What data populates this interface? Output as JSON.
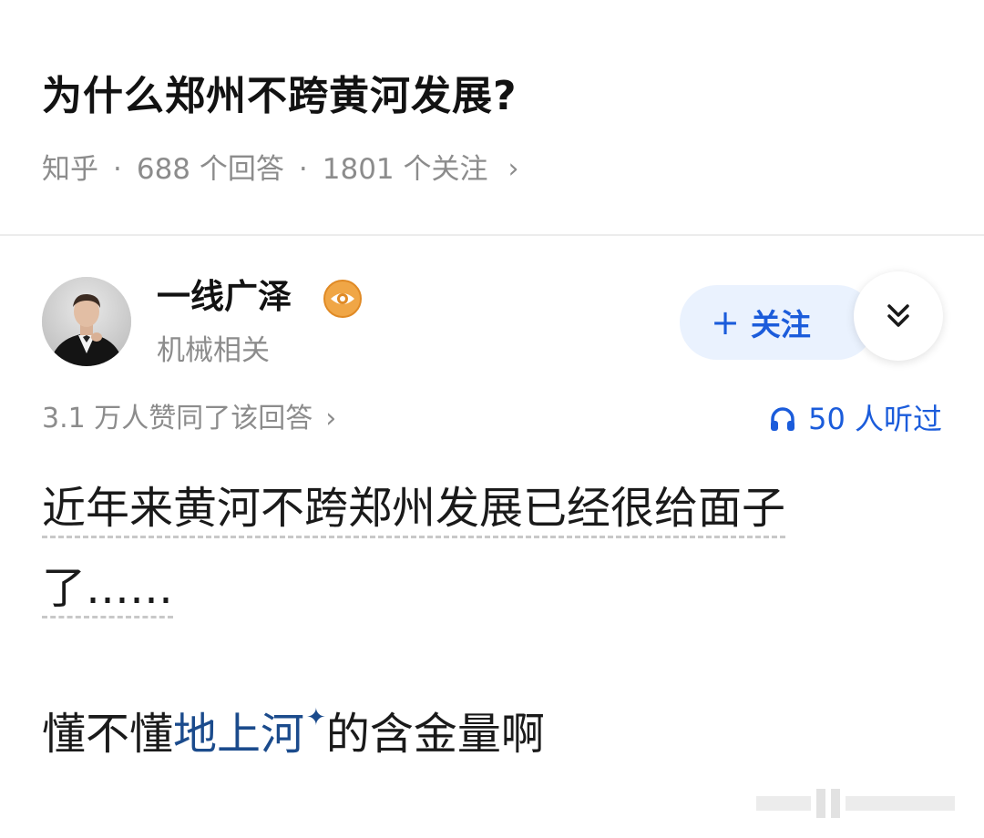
{
  "question": {
    "title": "为什么郑州不跨黄河发展?",
    "source": "知乎",
    "answers": "688 个回答",
    "followers": "1801 个关注",
    "chevron": "›"
  },
  "author": {
    "name": "一线广泽",
    "badge_icon": "eye-badge-icon",
    "bio": "机械相关",
    "follow_plus": "+",
    "follow_label": "关注",
    "more_icon": "double-chevron-down-icon"
  },
  "stats": {
    "likes": "3.1 万人赞同了该回答",
    "likes_chevron": "›",
    "listen_icon": "headphones-icon",
    "listens": "50 人听过"
  },
  "content": {
    "line1": "近年来黄河不跨郑州发展已经很给面子",
    "line2": "了……",
    "p2_prefix": "懂不懂",
    "p2_link": "地上河",
    "p2_spark": "✦",
    "p2_suffix": "的含金量啊"
  },
  "colors": {
    "accent": "#1b5cdb",
    "follow_bg": "#eaf2fe",
    "muted": "#8c8c8c",
    "link": "#1b4b8c",
    "badge": "#f0a646"
  }
}
